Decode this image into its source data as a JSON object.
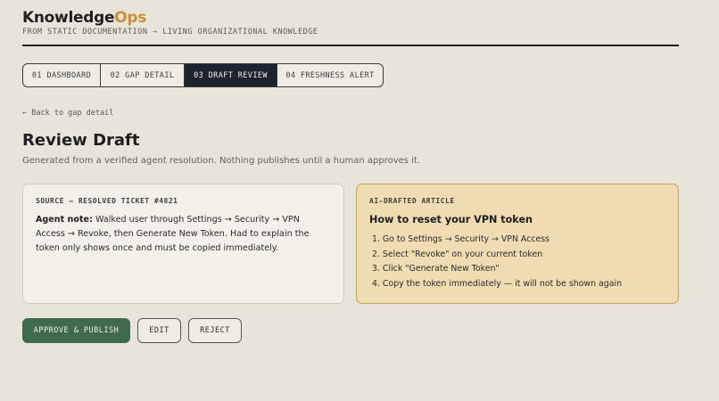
{
  "brand": {
    "name_main": "Knowledge",
    "name_accent": "Ops",
    "tagline": "FROM STATIC DOCUMENTATION → LIVING ORGANIZATIONAL KNOWLEDGE"
  },
  "tabs": [
    {
      "label": "01 DASHBOARD",
      "active": false
    },
    {
      "label": "02 GAP DETAIL",
      "active": false
    },
    {
      "label": "03 DRAFT REVIEW",
      "active": true
    },
    {
      "label": "04 FRESHNESS ALERT",
      "active": false
    }
  ],
  "back_link": "← Back to gap detail",
  "page": {
    "title": "Review Draft",
    "subtitle": "Generated from a verified agent resolution. Nothing publishes until a human approves it."
  },
  "source_card": {
    "heading": "SOURCE — RESOLVED TICKET #4821",
    "note_label": "Agent note:",
    "note_text": " Walked user through Settings → Security → VPN Access → Revoke, then Generate New Token. Had to explain the token only shows once and must be copied immediately."
  },
  "draft_card": {
    "heading": "AI-DRAFTED ARTICLE",
    "article_title": "How to reset your VPN token",
    "steps": [
      "1. Go to Settings → Security → VPN Access",
      "2. Select \"Revoke\" on your current token",
      "3. Click \"Generate New Token\"",
      "4. Copy the token immediately — it will not be shown again"
    ]
  },
  "actions": {
    "approve_label": "APPROVE & PUBLISH",
    "edit_label": "EDIT",
    "reject_label": "REJECT"
  },
  "colors": {
    "background": "#e8e4da",
    "accent": "#c98f3b",
    "active_tab": "#1d2330",
    "approve": "#3f6b4c",
    "draft_card": "#f0dcb2"
  }
}
